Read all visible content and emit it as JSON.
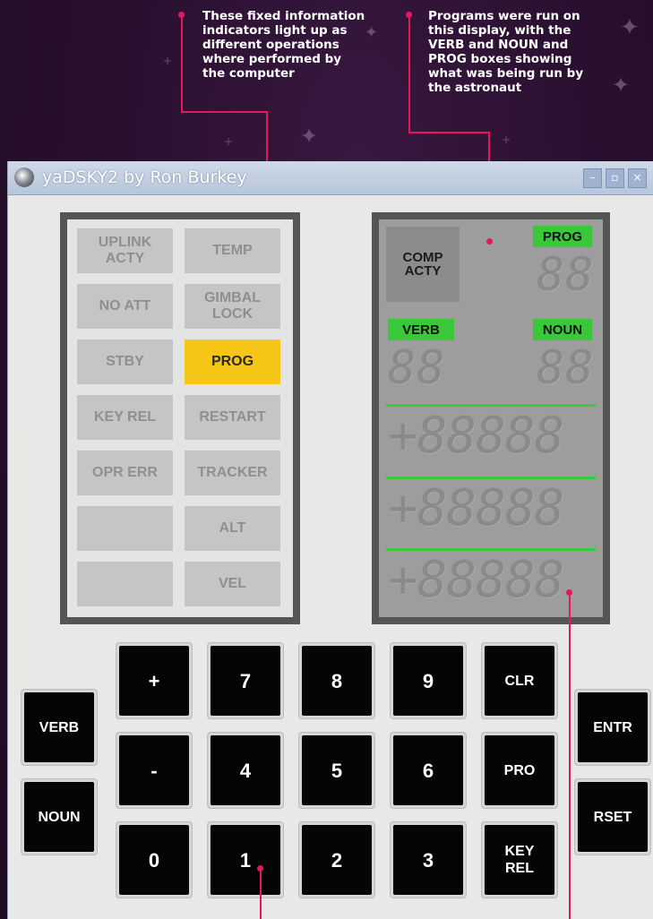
{
  "annotations": {
    "left": "These fixed information\nindicators light up as\ndifferent operations\nwhere performed by\nthe computer",
    "right": " Programs were run on\nthis display, with the\nVERB and NOUN and\nPROG boxes showing\nwhat was being run by\nthe astronaut"
  },
  "window": {
    "title": "yaDSKY2 by Ron Burkey",
    "controls": {
      "minimize": "–",
      "maximize": "▫",
      "close": "×"
    }
  },
  "indicators": {
    "left": [
      "UPLINK\nACTY",
      "NO ATT",
      "STBY",
      "KEY REL",
      "OPR ERR",
      "",
      ""
    ],
    "right": [
      "TEMP",
      "GIMBAL\nLOCK",
      "PROG",
      "RESTART",
      "TRACKER",
      "ALT",
      "VEL"
    ]
  },
  "display": {
    "comp_acty": "COMP\nACTY",
    "prog_label": "PROG",
    "verb_label": "VERB",
    "noun_label": "NOUN",
    "prog_digits": "88",
    "verb_digits": "88",
    "noun_digits": "88",
    "reg1": "+88888",
    "reg2": "+88888",
    "reg3": "+88888"
  },
  "keys": {
    "verb": "VERB",
    "noun": "NOUN",
    "plus": "+",
    "minus": "-",
    "zero": "0",
    "seven": "7",
    "four": "4",
    "one": "1",
    "eight": "8",
    "five": "5",
    "two": "2",
    "nine": "9",
    "six": "6",
    "three": "3",
    "clr": "CLR",
    "pro": "PRO",
    "key_rel": "KEY\nREL",
    "entr": "ENTR",
    "rset": "RSET"
  },
  "colors": {
    "accent_line": "#e8175d",
    "lamp_on": "#f5c518",
    "display_label_green": "#3ac83a"
  }
}
